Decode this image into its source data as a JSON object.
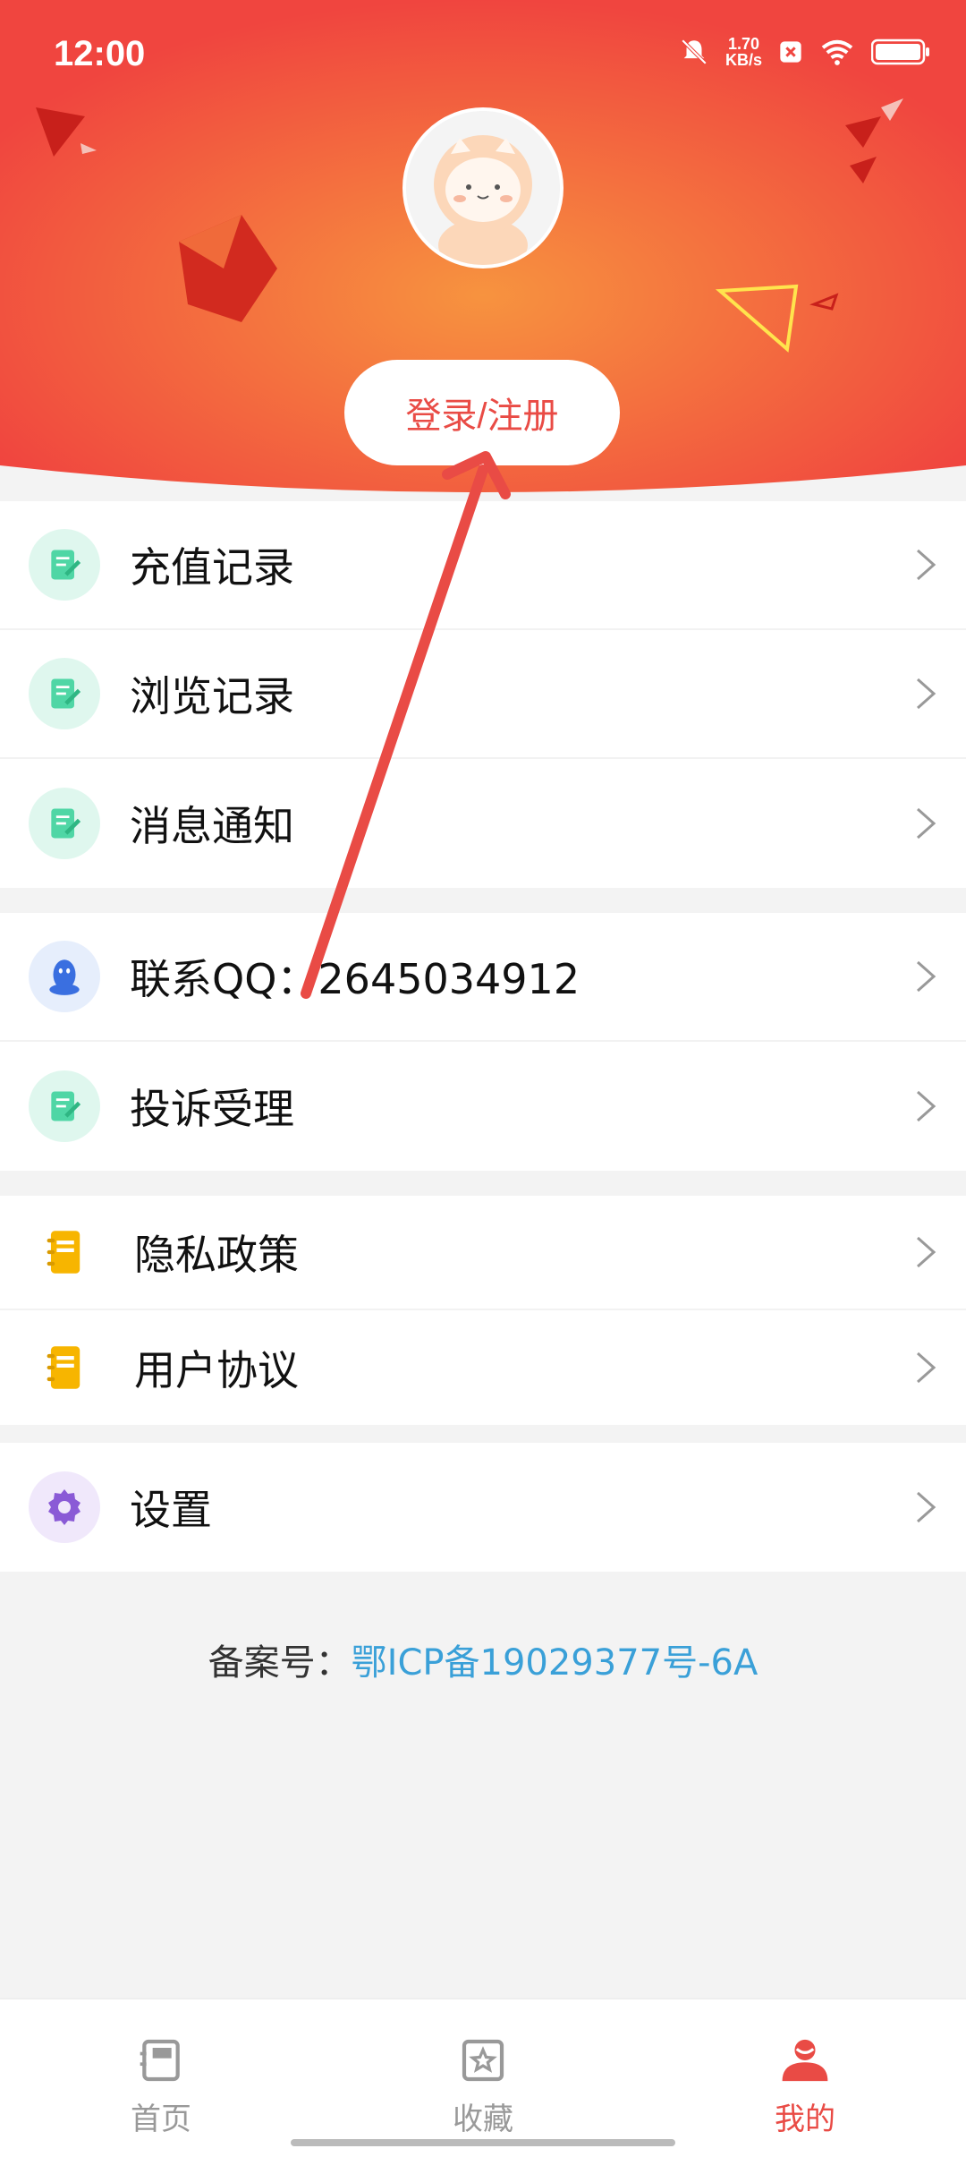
{
  "status_bar": {
    "time": "12:00",
    "speed_value": "1.70",
    "speed_unit": "KB/s"
  },
  "profile": {
    "login_label": "登录/注册"
  },
  "menu": {
    "group1": [
      {
        "label": "充值记录",
        "icon": "edit-note-icon"
      },
      {
        "label": "浏览记录",
        "icon": "edit-note-icon"
      },
      {
        "label": "消息通知",
        "icon": "edit-note-icon"
      }
    ],
    "group2": [
      {
        "label": "联系QQ：2645034912",
        "icon": "qq-penguin-icon"
      },
      {
        "label": "投诉受理",
        "icon": "edit-note-icon"
      }
    ],
    "group3": [
      {
        "label": "隐私政策",
        "icon": "notebook-icon"
      },
      {
        "label": "用户协议",
        "icon": "notebook-icon"
      }
    ],
    "group4": [
      {
        "label": "设置",
        "icon": "gear-icon"
      }
    ]
  },
  "footer": {
    "record_prefix": "备案号：",
    "record_number": "鄂ICP备19029377号-6A"
  },
  "tabbar": {
    "home": "首页",
    "favorites": "收藏",
    "mine": "我的"
  },
  "colors": {
    "accent": "#e94b45",
    "header_red": "#f0453f",
    "header_orange": "#f5813f",
    "link": "#3aa0d8"
  }
}
